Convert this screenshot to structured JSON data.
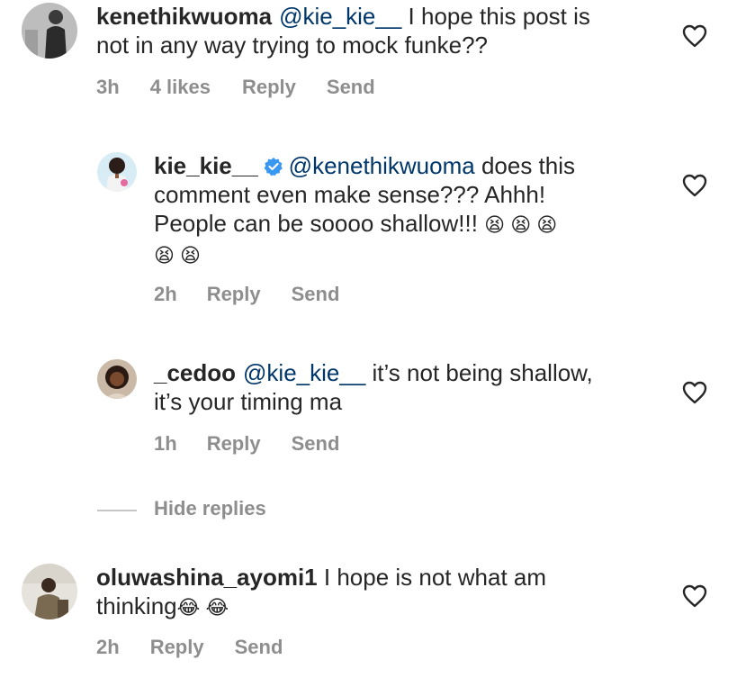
{
  "comments": [
    {
      "username": "kenethikwuoma",
      "mention": "@kie_kie__",
      "text_line1": " I hope this post is",
      "text_line2": "not in any way trying to mock funke??",
      "time": "3h",
      "likes": "4 likes",
      "reply_label": "Reply",
      "send_label": "Send"
    },
    {
      "username": "kie_kie__",
      "mention": "@kenethikwuoma",
      "text_line1": " does this",
      "text_line2": "comment even make sense??? Ahhh!",
      "text_line3": "People can be soooo shallow!!! ",
      "emoji_line3": "😫 😫 😫",
      "emoji_line4": "😫 😫",
      "time": "2h",
      "reply_label": "Reply",
      "send_label": "Send"
    },
    {
      "username": "_cedoo",
      "mention": "@kie_kie__",
      "text_line1": " it’s not being shallow,",
      "text_line2": "it’s your timing ma",
      "time": "1h",
      "reply_label": "Reply",
      "send_label": "Send"
    },
    {
      "username": "oluwashina_ayomi1",
      "text_line1": " I hope is not what am",
      "text_line2": "thinking",
      "emoji_line2": "😂 😂",
      "time": "2h",
      "reply_label": "Reply",
      "send_label": "Send"
    }
  ],
  "hide_replies_label": "Hide replies",
  "colors": {
    "text": "#262626",
    "muted": "#8e8e8e",
    "mention": "#00376b",
    "verified": "#3897f0"
  },
  "icons": {
    "like": "heart-icon",
    "verified": "verified-badge-icon"
  }
}
